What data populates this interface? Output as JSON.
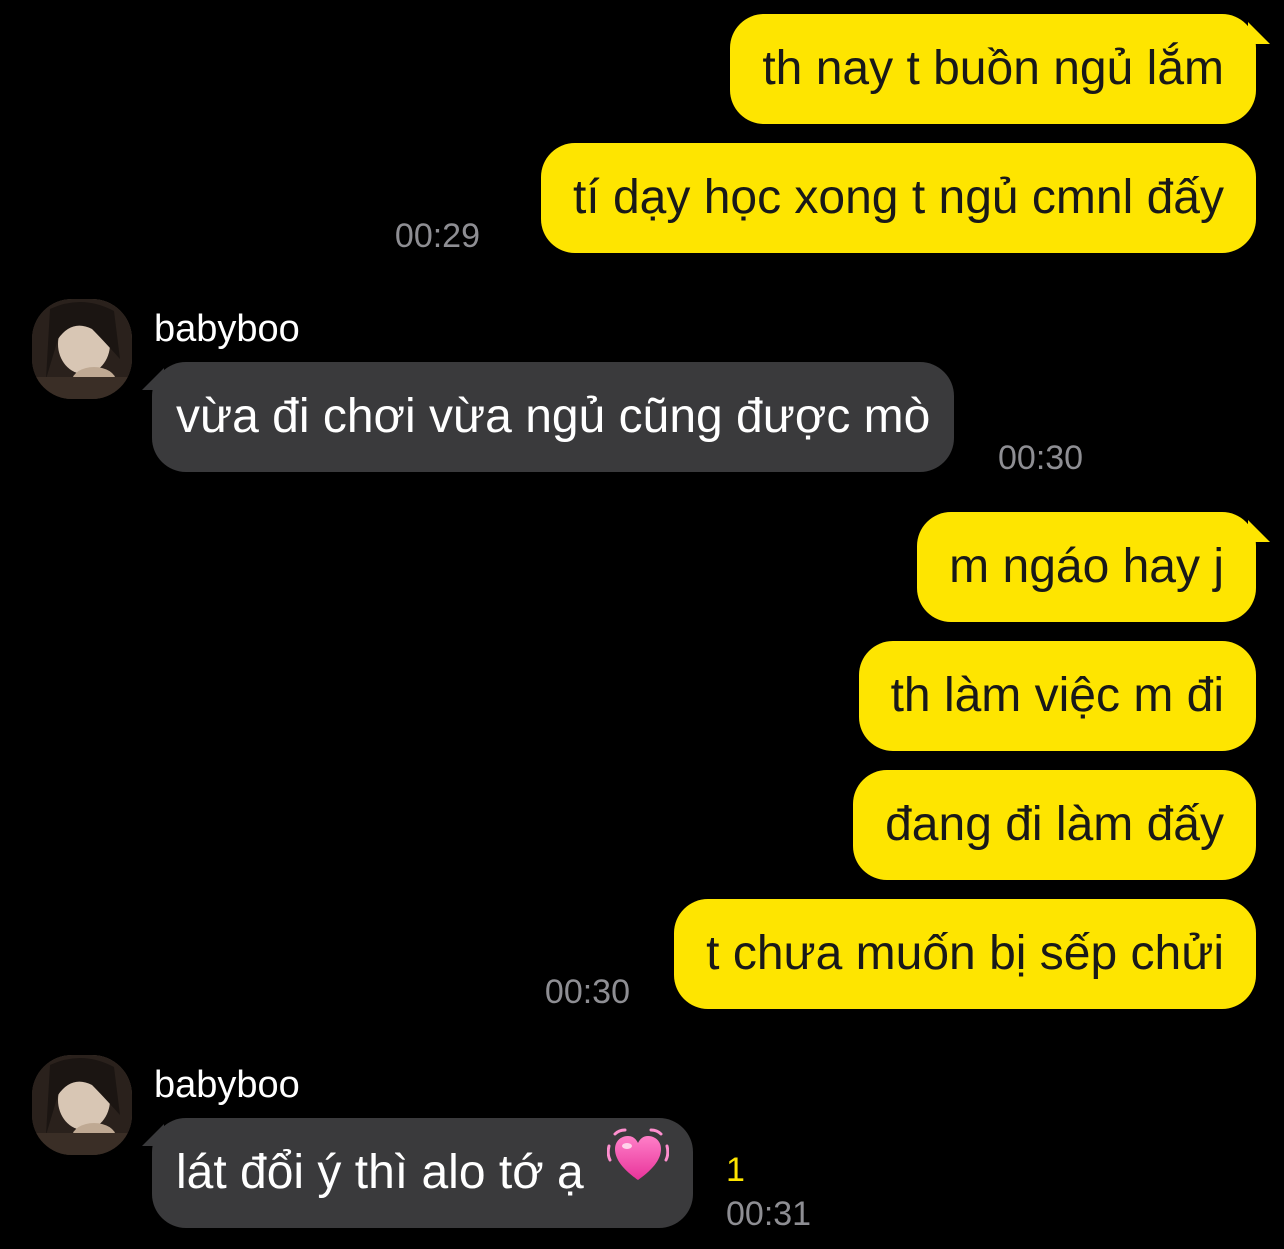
{
  "colors": {
    "background": "#000000",
    "my_bubble": "#FEE500",
    "their_bubble": "#3A3A3C",
    "timestamp": "#8E8E93",
    "unread": "#FEE500"
  },
  "messages": [
    {
      "from": "me",
      "text": "th nay t buồn ngủ lắm"
    },
    {
      "from": "me",
      "text": "tí dạy học xong t ngủ cmnl đấy",
      "time": "00:29"
    },
    {
      "from": "babyboo",
      "sender": "babyboo",
      "text": "vừa đi chơi vừa ngủ cũng được mò",
      "time": "00:30"
    },
    {
      "from": "me",
      "text": "m ngáo hay j"
    },
    {
      "from": "me",
      "text": "th làm việc m đi"
    },
    {
      "from": "me",
      "text": "đang đi làm đấy"
    },
    {
      "from": "me",
      "text": "t chưa muốn bị sếp chửi",
      "time": "00:30"
    },
    {
      "from": "babyboo",
      "sender": "babyboo",
      "text": "lát đổi ý thì alo tớ ạ",
      "emoji": "heart-icon",
      "unread_count": "1",
      "time": "00:31"
    }
  ]
}
